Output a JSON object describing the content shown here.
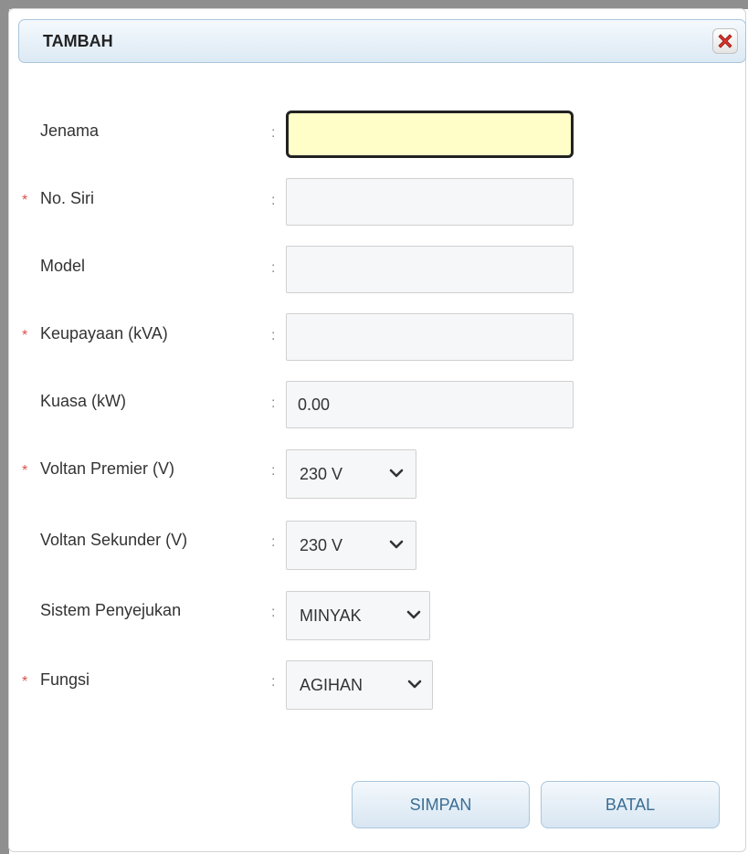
{
  "dialog": {
    "title": "TAMBAH",
    "close_icon": "close-x-icon"
  },
  "form": {
    "fields": [
      {
        "label": "Jenama",
        "required": false,
        "type": "text",
        "value": "",
        "focused": true
      },
      {
        "label": "No. Siri",
        "required": true,
        "type": "text",
        "value": ""
      },
      {
        "label": "Model",
        "required": false,
        "type": "text",
        "value": ""
      },
      {
        "label": "Keupayaan (kVA)",
        "required": true,
        "type": "text",
        "value": ""
      },
      {
        "label": "Kuasa (kW)",
        "required": false,
        "type": "text",
        "value": "0.00"
      },
      {
        "label": "Voltan Premier (V)",
        "required": true,
        "type": "select",
        "value": "230 V"
      },
      {
        "label": "Voltan Sekunder (V)",
        "required": false,
        "type": "select",
        "value": "230 V"
      },
      {
        "label": "Sistem Penyejukan",
        "required": false,
        "type": "select",
        "value": "MINYAK"
      },
      {
        "label": "Fungsi",
        "required": true,
        "type": "select",
        "value": "AGIHAN"
      }
    ],
    "separator": ":",
    "required_mark": "*"
  },
  "buttons": {
    "save": "SIMPAN",
    "cancel": "BATAL"
  },
  "colors": {
    "required": "#d9534f",
    "focus_bg": "#fffdc8",
    "button_text": "#3b6e94"
  }
}
